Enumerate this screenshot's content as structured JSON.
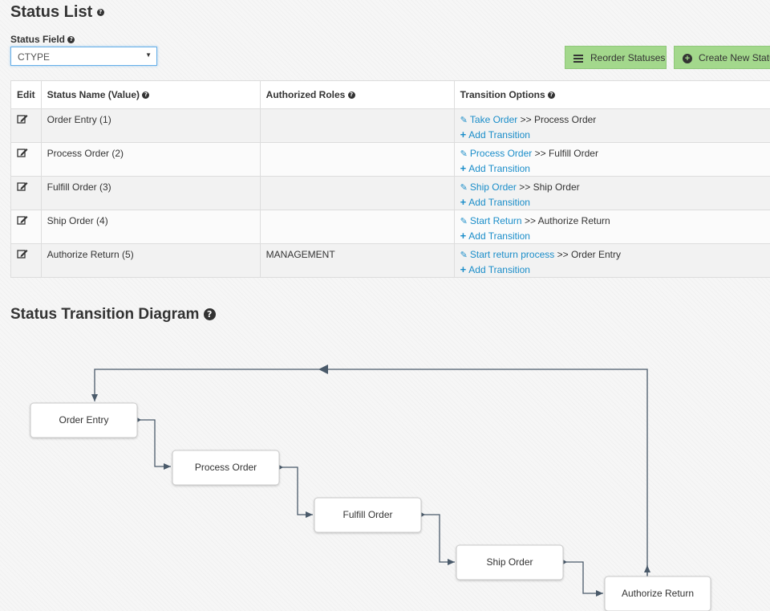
{
  "status_list": {
    "title": "Status List",
    "field_label": "Status Field",
    "field_value": "CTYPE",
    "reorder_button": "Reorder Statuses",
    "create_button": "Create New Status"
  },
  "table": {
    "headers": [
      "Edit",
      "Status Name (Value)",
      "Authorized Roles",
      "Transition Options"
    ],
    "rows": [
      {
        "name": "Order Entry (1)",
        "roles": "",
        "transition_link": "Take Order",
        "transition_target": ">> Process Order",
        "add": "Add Transition"
      },
      {
        "name": "Process Order (2)",
        "roles": "",
        "transition_link": "Process Order",
        "transition_target": ">> Fulfill Order",
        "add": "Add Transition"
      },
      {
        "name": "Fulfill Order (3)",
        "roles": "",
        "transition_link": "Ship Order",
        "transition_target": ">> Ship Order",
        "add": "Add Transition"
      },
      {
        "name": "Ship Order (4)",
        "roles": "",
        "transition_link": "Start Return",
        "transition_target": ">> Authorize Return",
        "add": "Add Transition"
      },
      {
        "name": "Authorize Return (5)",
        "roles": "MANAGEMENT",
        "transition_link": "Start return process",
        "transition_target": ">> Order Entry",
        "add": "Add Transition"
      }
    ]
  },
  "diagram": {
    "title": "Status Transition Diagram",
    "nodes": [
      "Order Entry",
      "Process Order",
      "Fulfill Order",
      "Ship Order",
      "Authorize Return"
    ]
  },
  "colors": {
    "link": "#1a8dc9",
    "button_green": "#a3d88c",
    "connector": "#4a5a6a"
  }
}
